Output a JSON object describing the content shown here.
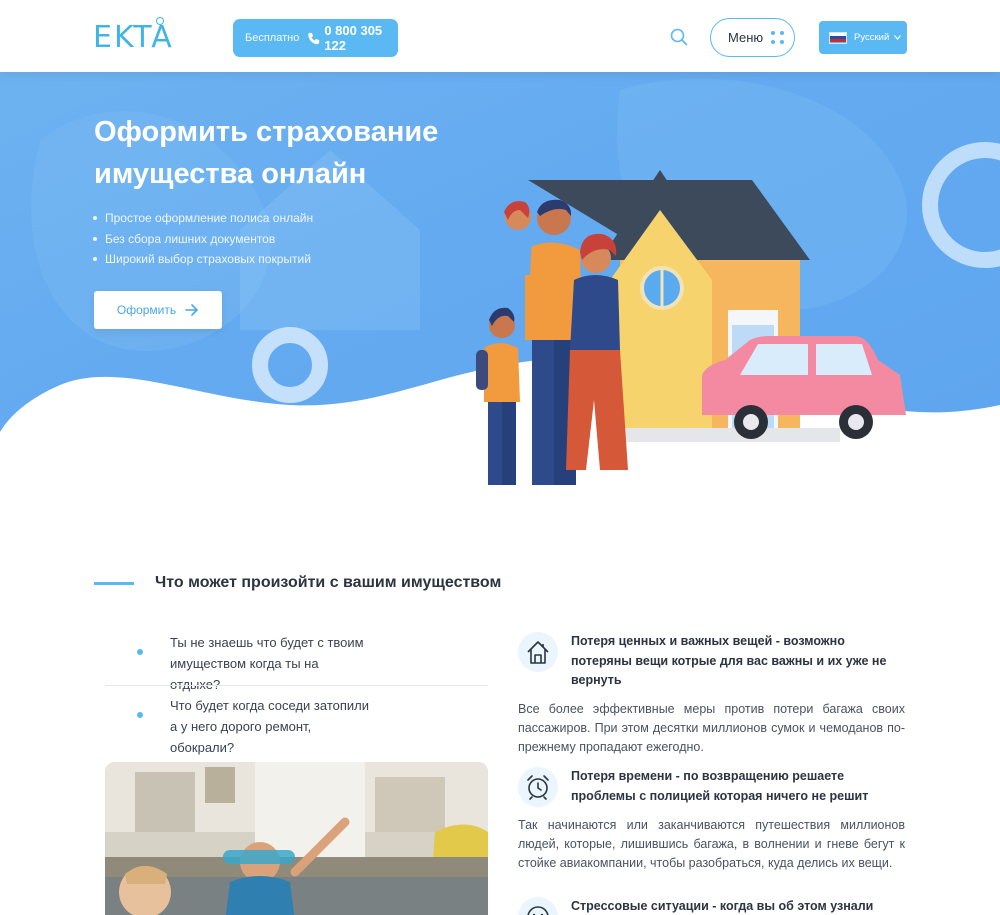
{
  "header": {
    "logo": "EKTA",
    "phone_free": "Бесплатно",
    "phone_number": "0 800 305 122",
    "menu_label": "Меню",
    "language_label": "Русский"
  },
  "hero": {
    "title": "Оформить страхование имущества онлайн",
    "bullets": [
      "Простое оформление полиса онлайн",
      "Без сбора лишних документов",
      "Широкий выбор страховых покрытий"
    ],
    "cta_label": "Оформить"
  },
  "section": {
    "title": "Что может произойти с вашим имуществом",
    "questions": [
      "Ты не знаешь что будет с твоим имуществом когда ты на отдыхе?",
      "Что будет когда соседи затопили а у него дорого ремонт, обокрали?"
    ],
    "risks": [
      {
        "icon": "house-icon",
        "title": "Потеря ценных и важных вещей - возможно потеряны вещи котрые для вас важны и их уже не вернуть",
        "text": "Все более эффективные меры против потери багажа своих пассажиров. При этом десятки миллионов сумок и чемоданов по-прежнему пропадают ежегодно."
      },
      {
        "icon": "alarm-clock-icon",
        "title": "Потеря времени - по возвращению решаете проблемы с полицией которая ничего не решит",
        "text": "Так начинаются или заканчиваются путешествия миллионов людей, которые, лишившись багажа, в волнении и гневе бегут к стойке авиакомпании, чтобы разобраться, куда делись их вещи."
      },
      {
        "icon": "stress-face-icon",
        "title": "Стрессовые ситуации - когда вы об этом узнали",
        "text": ""
      }
    ]
  },
  "colors": {
    "accent": "#5ab8f2",
    "hero_blue": "#5aaaf0",
    "text_dark": "#2c3440"
  }
}
